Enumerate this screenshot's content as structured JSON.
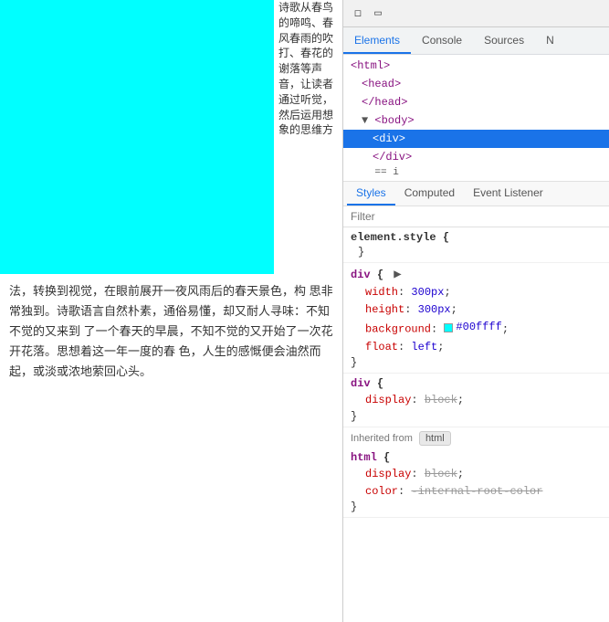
{
  "webpage": {
    "side_text": "诗歌从春鸟的啼鸣、春风春雨的吹打、春花的谢落等声音，让读者通过听觉，然后运用想象的思维方",
    "side_text2": "法，转换到视觉，在眼前展开一夜风雨后的春天景色，构 思非常独到。",
    "below_text": "法，转换到视觉，在眼前展开一夜风雨后的春天景色，构 思非常独到。诗歌语言自然朴素，通俗易懂，却又耐人寻味：不知不觉的又来到 了一个春天的早晨，不知不觉的又开始了一次花开花落。思想着这一年一度的春 色，人生的感慨便会油然而起，或淡或浓地萦回心头。",
    "overflow_text": "诗歌从春鸟的啼鸣、春风春雨的吹打、春花的谢落等声音，让读者通过听觉，然后运用想象的思维方法，转换到视觉，在眼前展开一夜风雨后的春天景色，构思非常独到。诗歌语言自然朴素，通俗易懂，却又耐人寻味：不知不觉的又来到"
  },
  "devtools": {
    "top_icons": [
      "☰",
      "⬡"
    ],
    "main_tabs": [
      {
        "label": "Elements",
        "active": true
      },
      {
        "label": "Console",
        "active": false
      },
      {
        "label": "Sources",
        "active": false
      },
      {
        "label": "N",
        "active": false
      }
    ],
    "dom": {
      "lines": [
        {
          "indent": 0,
          "html": "&lt;html&gt;",
          "tag": "html"
        },
        {
          "indent": 1,
          "html": "&lt;head&gt;",
          "tag": "head"
        },
        {
          "indent": 1,
          "html": "&lt;/head&gt;",
          "tag": "/head"
        },
        {
          "indent": 1,
          "html": "▼ &lt;body&gt;",
          "tag": "body"
        },
        {
          "indent": 2,
          "html": "&lt;div&gt;",
          "tag": "div",
          "selected": true
        },
        {
          "indent": 2,
          "html": "&lt;/div&gt;",
          "tag": "/div"
        },
        {
          "indent": 2,
          "html": "== i",
          "equals": true
        }
      ]
    },
    "style_tabs": [
      {
        "label": "Styles",
        "active": true
      },
      {
        "label": "Computed",
        "active": false
      },
      {
        "label": "Event Listener",
        "active": false
      }
    ],
    "filter_placeholder": "Filter",
    "css_blocks": [
      {
        "id": "element-style",
        "selector": "element.style",
        "properties": [
          {
            "name": "",
            "value": ""
          }
        ],
        "empty": true
      },
      {
        "id": "div-block1",
        "selector": "div",
        "properties": [
          {
            "name": "width",
            "value": "300px"
          },
          {
            "name": "height",
            "value": "300px"
          },
          {
            "name": "background",
            "value": "#00ffff",
            "is_color": true,
            "color_hex": "#00ffff"
          },
          {
            "name": "float",
            "value": "left"
          }
        ]
      },
      {
        "id": "div-block2",
        "selector": "div",
        "properties": [
          {
            "name": "display",
            "value": "block",
            "grayed": true
          }
        ]
      }
    ],
    "inherited_from": "Inherited from",
    "inherited_tag": "html",
    "inherited_block": {
      "selector": "html",
      "properties": [
        {
          "name": "display",
          "value": "block",
          "grayed": true
        },
        {
          "name": "color",
          "value": "-internal-root-color",
          "grayed": true
        }
      ]
    }
  }
}
